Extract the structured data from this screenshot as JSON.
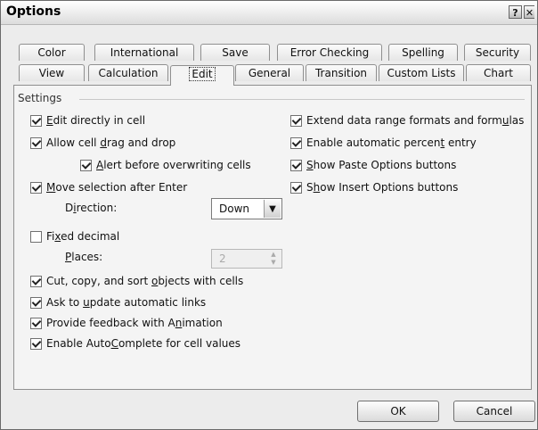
{
  "window": {
    "title": "Options",
    "help_glyph": "?",
    "close_glyph": "✕"
  },
  "tabs_row1": [
    "Color",
    "International",
    "Save",
    "Error Checking",
    "Spelling",
    "Security"
  ],
  "tabs_row2": [
    "View",
    "Calculation",
    "Edit",
    "General",
    "Transition",
    "Custom Lists",
    "Chart"
  ],
  "active_tab": "Edit",
  "settings": {
    "group_label": "Settings",
    "edit_directly": {
      "pre": "",
      "u": "E",
      "post": "dit directly in cell",
      "checked": true
    },
    "cell_drag": {
      "pre": "Allow cell ",
      "u": "d",
      "post": "rag and drop",
      "checked": true
    },
    "alert_overwrite": {
      "pre": "",
      "u": "A",
      "post": "lert before overwriting cells",
      "checked": true
    },
    "move_selection": {
      "pre": "",
      "u": "M",
      "post": "ove selection after Enter",
      "checked": true
    },
    "direction_label": {
      "pre": "D",
      "u": "i",
      "post": "rection:"
    },
    "direction_value": "Down",
    "fixed_decimal": {
      "pre": "Fi",
      "u": "x",
      "post": "ed decimal",
      "checked": false
    },
    "places_label": {
      "pre": "",
      "u": "P",
      "post": "laces:"
    },
    "places_value": "2",
    "cut_copy_sort": {
      "pre": "Cut, copy, and sort ",
      "u": "o",
      "post": "bjects with cells",
      "checked": true
    },
    "update_links": {
      "pre": "Ask to ",
      "u": "u",
      "post": "pdate automatic links",
      "checked": true
    },
    "feedback_animation": {
      "pre": "Provide feedback with A",
      "u": "n",
      "post": "imation",
      "checked": true
    },
    "autocomplete": {
      "pre": "Enable Auto",
      "u": "C",
      "post": "omplete for cell values",
      "checked": true
    },
    "extend_range": {
      "pre": "Extend data range formats and form",
      "u": "u",
      "post": "las",
      "checked": true
    },
    "auto_percent": {
      "pre": "Enable automatic percen",
      "u": "t",
      "post": " entry",
      "checked": true
    },
    "paste_options": {
      "pre": "",
      "u": "S",
      "post": "how Paste Options buttons",
      "checked": true
    },
    "insert_options": {
      "pre": "S",
      "u": "h",
      "post": "ow Insert Options buttons",
      "checked": true
    }
  },
  "buttons": {
    "ok": "OK",
    "cancel": "Cancel"
  }
}
